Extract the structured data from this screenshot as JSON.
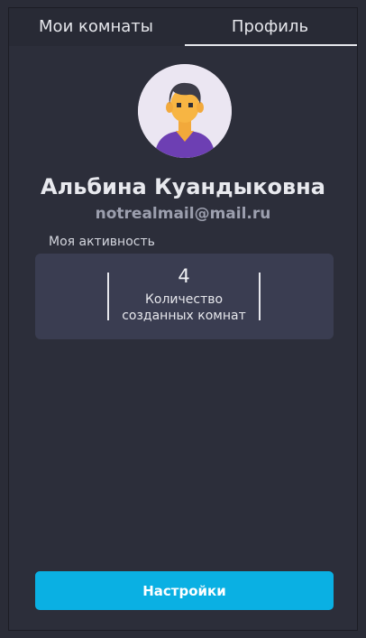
{
  "tabs": [
    {
      "label": "Мои комнаты",
      "active": false
    },
    {
      "label": "Профиль",
      "active": true
    }
  ],
  "profile": {
    "avatar_icon": "user-avatar-icon",
    "name": "Альбина Куандыковна",
    "email": "notrealmail@mail.ru"
  },
  "activity": {
    "label": "Моя активность",
    "stats": [
      {
        "value": "4",
        "caption_line1": "Количество",
        "caption_line2": "созданных комнат"
      }
    ]
  },
  "actions": {
    "settings_label": "Настройки"
  },
  "colors": {
    "background": "#2c2e3a",
    "card": "#3a3d51",
    "accent": "#0ab0e3"
  }
}
